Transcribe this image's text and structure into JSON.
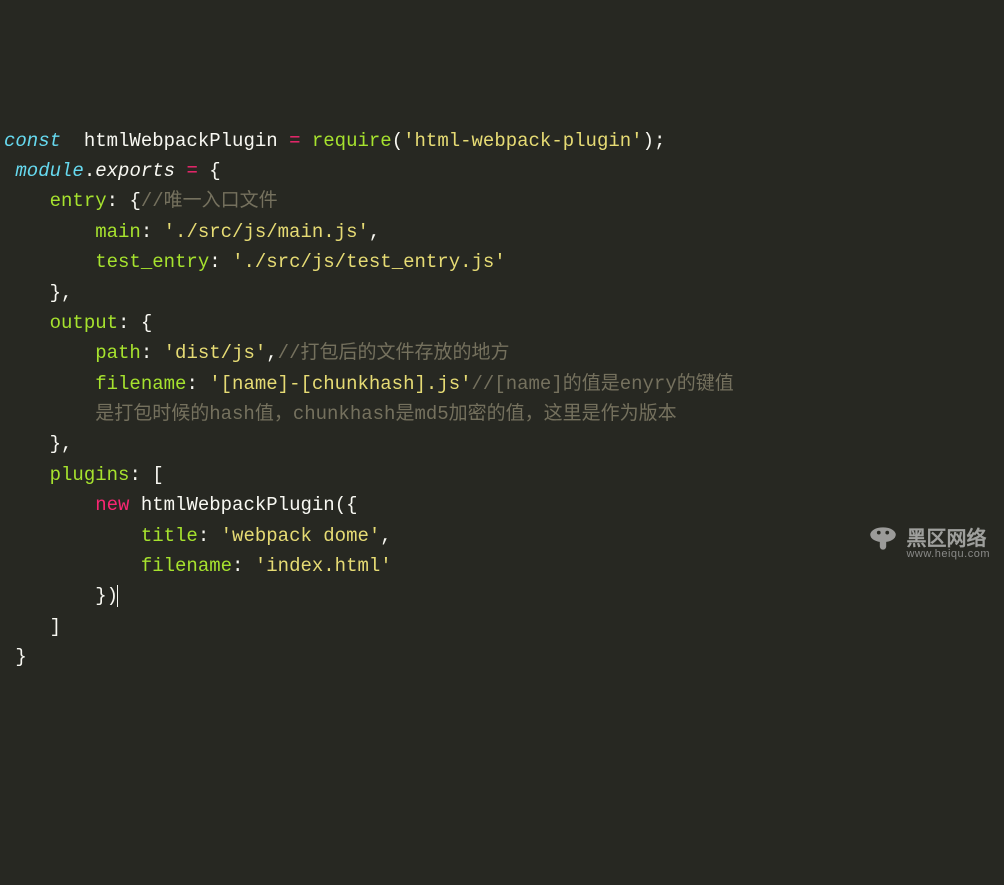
{
  "tokens": {
    "l1_const": "const",
    "l1_ident": "  htmlWebpackPlugin ",
    "l1_eq": "= ",
    "l1_require": "require",
    "l1_paren_o": "(",
    "l1_str": "'html-webpack-plugin'",
    "l1_paren_c": ")",
    "l1_semi": ";",
    "l2_module": " module",
    "l2_dot": ".",
    "l2_exports": "exports",
    "l2_sp_eq": " = ",
    "l2_brace_o": "{",
    "l3_pad": "    ",
    "l3_entry": "entry",
    "l3_colon": ": ",
    "l3_brace_o": "{",
    "l3_comment": "//唯一入口文件",
    "l4_pad": "        ",
    "l4_main": "main",
    "l4_colon": ": ",
    "l4_str": "'./src/js/main.js'",
    "l4_comma": ",",
    "l5_pad": "        ",
    "l5_test": "test_entry",
    "l5_colon": ": ",
    "l5_str": "'./src/js/test_entry.js'",
    "l6_pad": "    ",
    "l6_brace_c": "}",
    "l6_comma": ",",
    "l7_pad": "    ",
    "l7_output": "output",
    "l7_colon": ": ",
    "l7_brace_o": "{",
    "l8_pad": "        ",
    "l8_path": "path",
    "l8_colon": ": ",
    "l8_str": "'dist/js'",
    "l8_comma": ",",
    "l8_comment": "//打包后的文件存放的地方",
    "l9_pad": "        ",
    "l9_filename": "filename",
    "l9_colon": ": ",
    "l9_str": "'[name]-[chunkhash].js'",
    "l9_comment": "//[name]的值是enyry的键值",
    "l10_pad": "        ",
    "l10_comment": "是打包时候的hash值，chunkhash是md5加密的值，这里是作为版本",
    "l11_pad": "    ",
    "l11_brace_c": "}",
    "l11_comma": ",",
    "l12_pad": "    ",
    "l12_plugins": "plugins",
    "l12_colon": ": ",
    "l12_bracket_o": "[",
    "l13_pad": "        ",
    "l13_new": "new",
    "l13_sp": " ",
    "l13_ident": "htmlWebpackPlugin",
    "l13_paren_o": "(",
    "l13_brace_o": "{",
    "l14_pad": "            ",
    "l14_title": "title",
    "l14_colon": ": ",
    "l14_str": "'webpack dome'",
    "l14_comma": ",",
    "l15_pad": "            ",
    "l15_filename": "filename",
    "l15_colon": ": ",
    "l15_str": "'index.html'",
    "l16_pad": "        ",
    "l16_brace_c": "}",
    "l16_paren_c": ")",
    "l17_pad": "    ",
    "l17_bracket_c": "]",
    "l18_brace_c": " }"
  },
  "watermark": {
    "cn": "黑区网络",
    "url": "www.heiqu.com"
  }
}
